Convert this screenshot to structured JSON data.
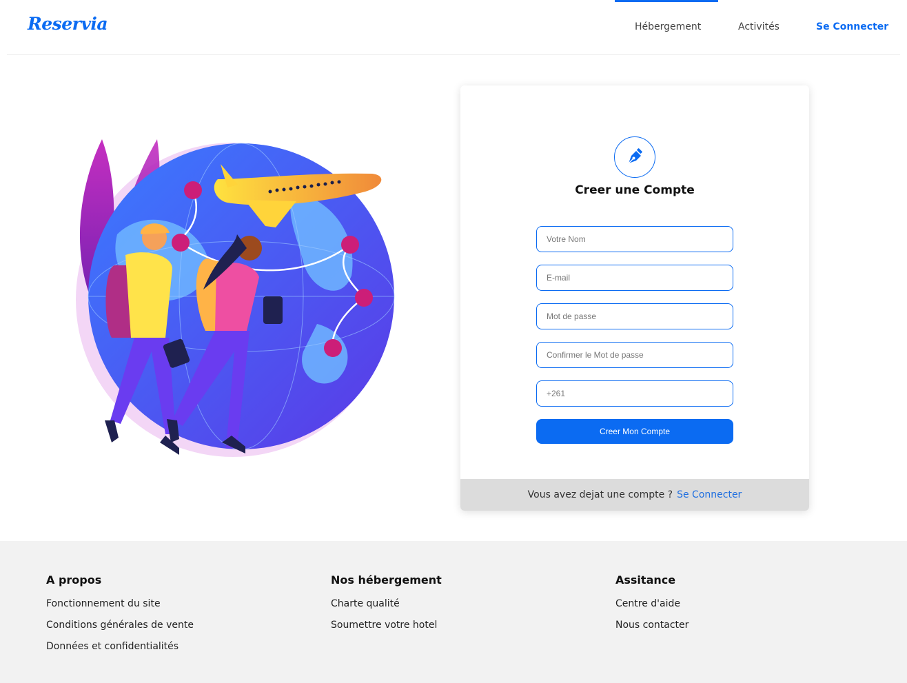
{
  "header": {
    "logo": "Reservia",
    "nav": {
      "hebergement": "Hébergement",
      "activites": "Activités",
      "login": "Se Connecter"
    }
  },
  "form": {
    "icon": "pen-nib-icon",
    "title": "Creer une Compte",
    "fields": {
      "name": "Votre Nom",
      "email": "E-mail",
      "password": "Mot de passe",
      "confirm": "Confirmer le Mot de passe",
      "phone": "+261"
    },
    "submit": "Creer Mon Compte",
    "footer_text": "Vous avez dejat une compte ?",
    "footer_link": "Se Connecter"
  },
  "footer": {
    "col1": {
      "title": "A propos",
      "links": [
        "Fonctionnement du site",
        "Conditions générales de vente",
        "Données et confidentialités"
      ]
    },
    "col2": {
      "title": "Nos hébergement",
      "links": [
        "Charte qualité",
        "Soumettre votre hotel"
      ]
    },
    "col3": {
      "title": "Assitance",
      "links": [
        "Centre d'aide",
        "Nous contacter"
      ]
    }
  },
  "colors": {
    "accent": "#0b6bf2",
    "footer_bg": "#f2f2f2",
    "card_footer_bg": "#dcdcdc"
  }
}
